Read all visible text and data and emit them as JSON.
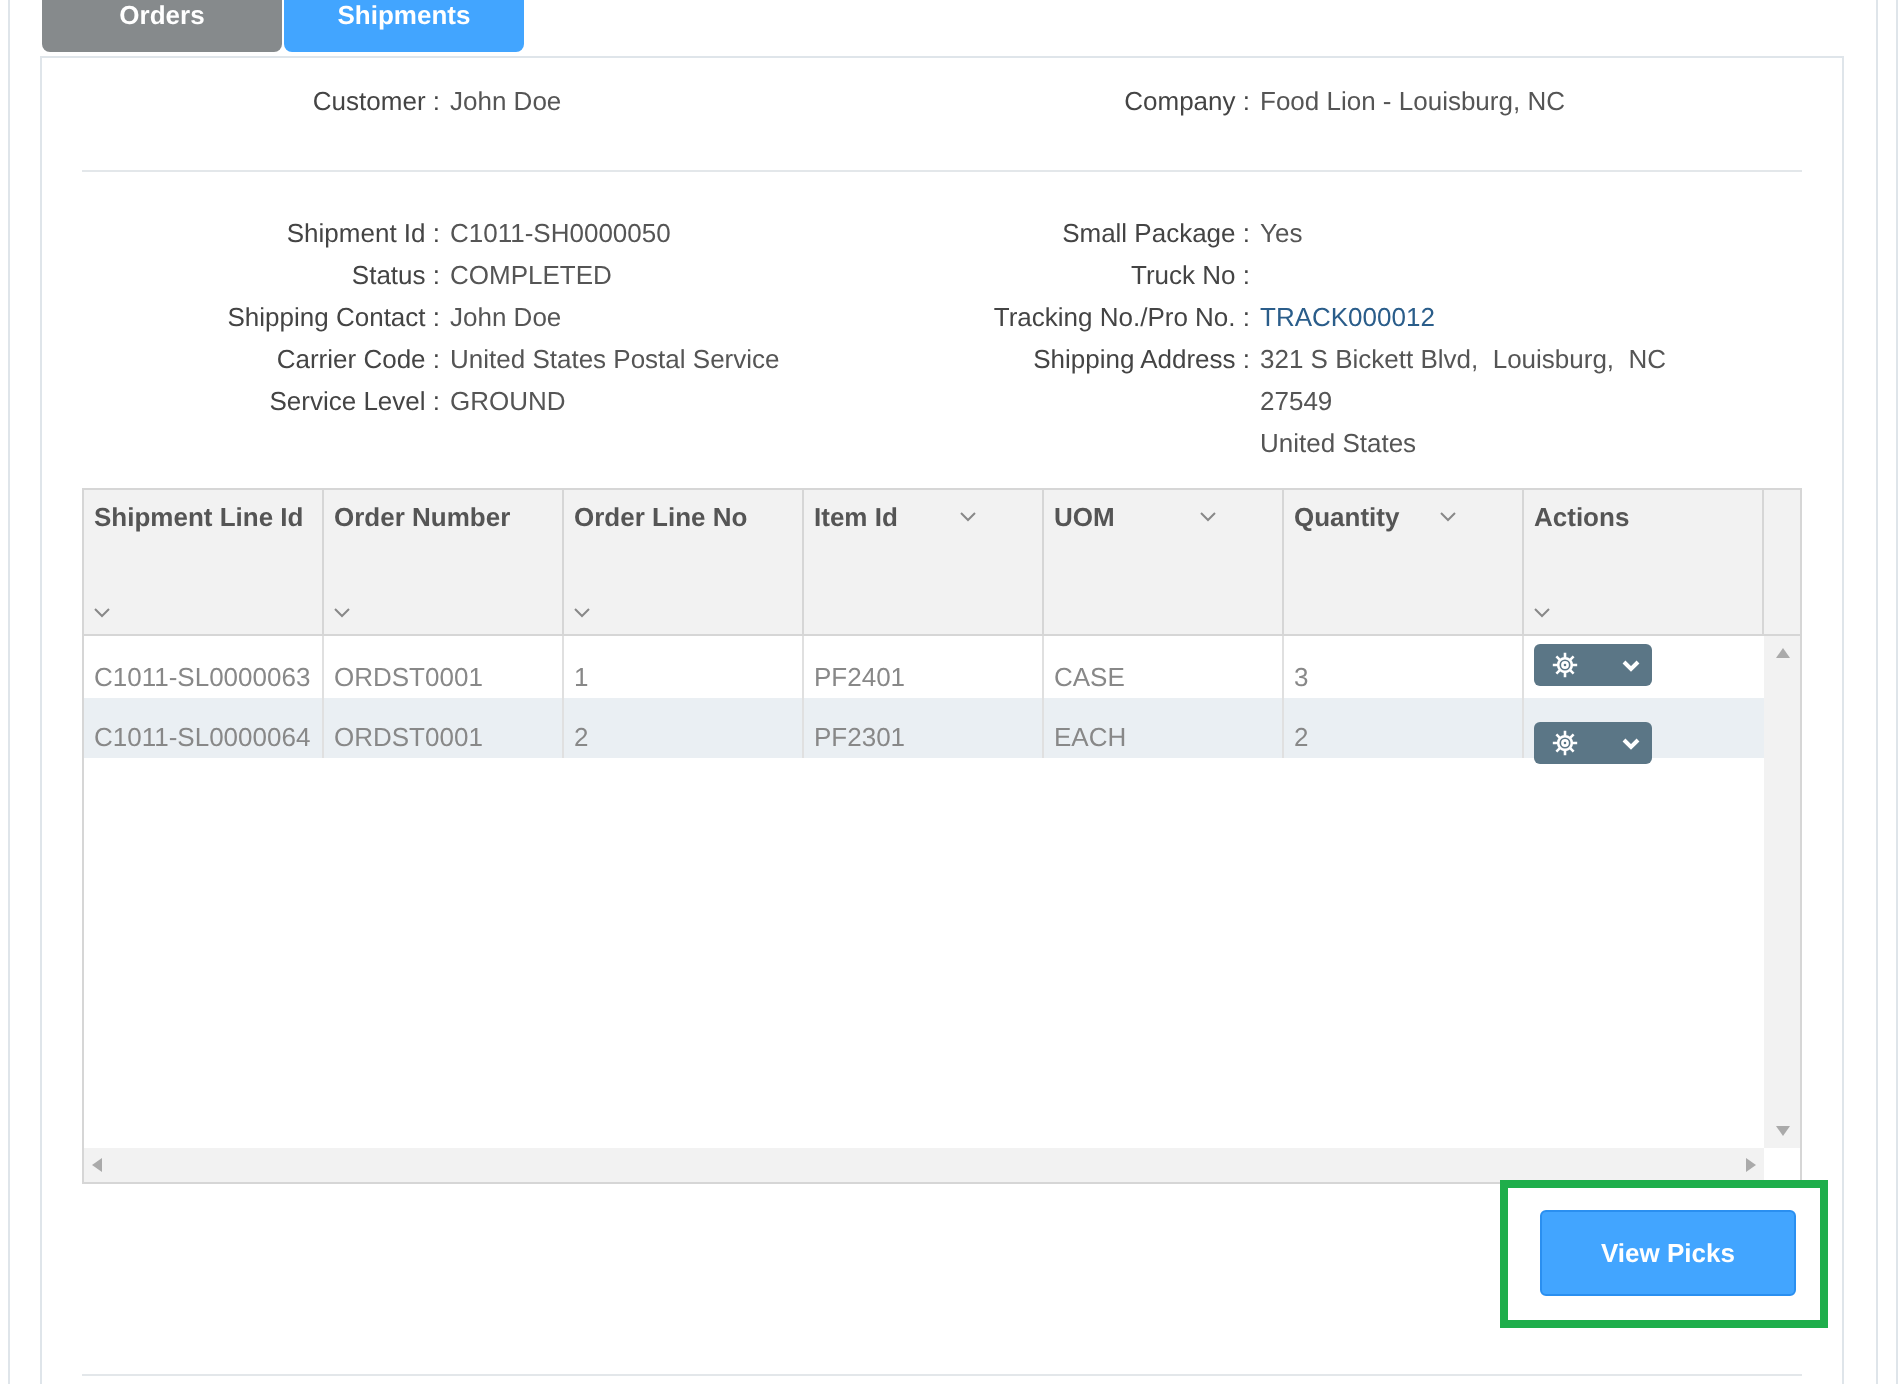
{
  "tabs": [
    {
      "label": "Orders",
      "selected": false
    },
    {
      "label": "Shipments",
      "selected": true
    }
  ],
  "header_fields": [
    {
      "label": "Customer :",
      "value": "John Doe"
    },
    {
      "label": "Company :",
      "value": "Food Lion - Louisburg, NC"
    }
  ],
  "details_left": [
    {
      "label": "Shipment Id :",
      "value": "C1011-SH0000050"
    },
    {
      "label": "Status :",
      "value": "COMPLETED"
    },
    {
      "label": "Shipping Contact :",
      "value": "John Doe"
    },
    {
      "label": "Carrier Code :",
      "value": "United States Postal Service"
    },
    {
      "label": "Service Level :",
      "value": "GROUND"
    }
  ],
  "details_right": [
    {
      "label": "Small Package :",
      "lines": [
        "Yes"
      ]
    },
    {
      "label": "Truck No :"
    },
    {
      "label": "Tracking No./Pro No. :",
      "lines": [
        "TRACK000012"
      ],
      "kind": "link"
    },
    {
      "label": "Shipping Address :",
      "lines": [
        "321 S Bickett Blvd,  Louisburg,  NC",
        "27549",
        "United States"
      ]
    }
  ],
  "table": {
    "columns": [
      {
        "label": "Shipment Line Id",
        "kind": "menu-below"
      },
      {
        "label": "Order Number",
        "kind": "menu-below"
      },
      {
        "label": "Order Line No",
        "kind": "menu-below"
      },
      {
        "label": "Item Id",
        "kind": "menu-beside"
      },
      {
        "label": "UOM",
        "kind": "menu-beside"
      },
      {
        "label": "Quantity",
        "kind": "menu-beside"
      },
      {
        "label": "Actions",
        "kind": "menu-below"
      }
    ],
    "rows": [
      {
        "cells": [
          "C1011-SL0000063",
          "ORDST0001",
          "1",
          "PF2401",
          "CASE",
          "3"
        ]
      },
      {
        "cells": [
          "C1011-SL0000064",
          "ORDST0001",
          "2",
          "PF2301",
          "EACH",
          "2"
        ]
      }
    ]
  },
  "view_picks_button": {
    "label": "View Picks",
    "highlighted": true
  }
}
